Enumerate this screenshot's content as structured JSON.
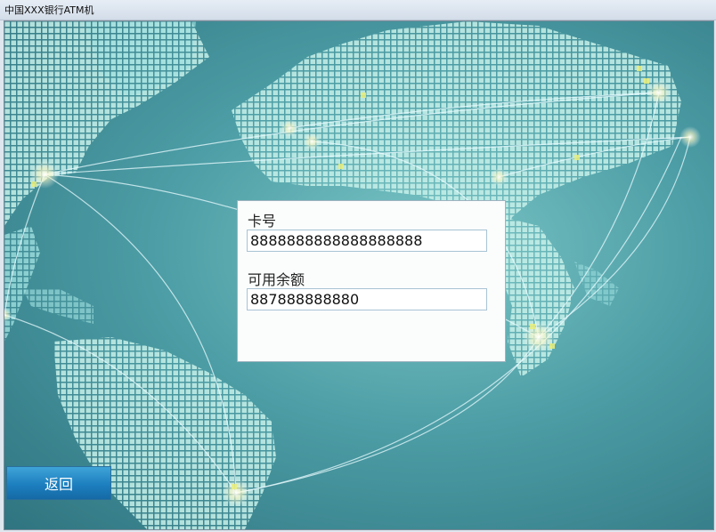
{
  "window": {
    "title": "中国XXX银行ATM机"
  },
  "account": {
    "card_label": "卡号",
    "card_number": "8888888888888888888",
    "balance_label": "可用余额",
    "balance_value": "887888888880"
  },
  "actions": {
    "back_label": "返回"
  },
  "colors": {
    "button": "#1d7fbf",
    "background": "#4d9ea6",
    "map_tile": "#bfeee6"
  }
}
